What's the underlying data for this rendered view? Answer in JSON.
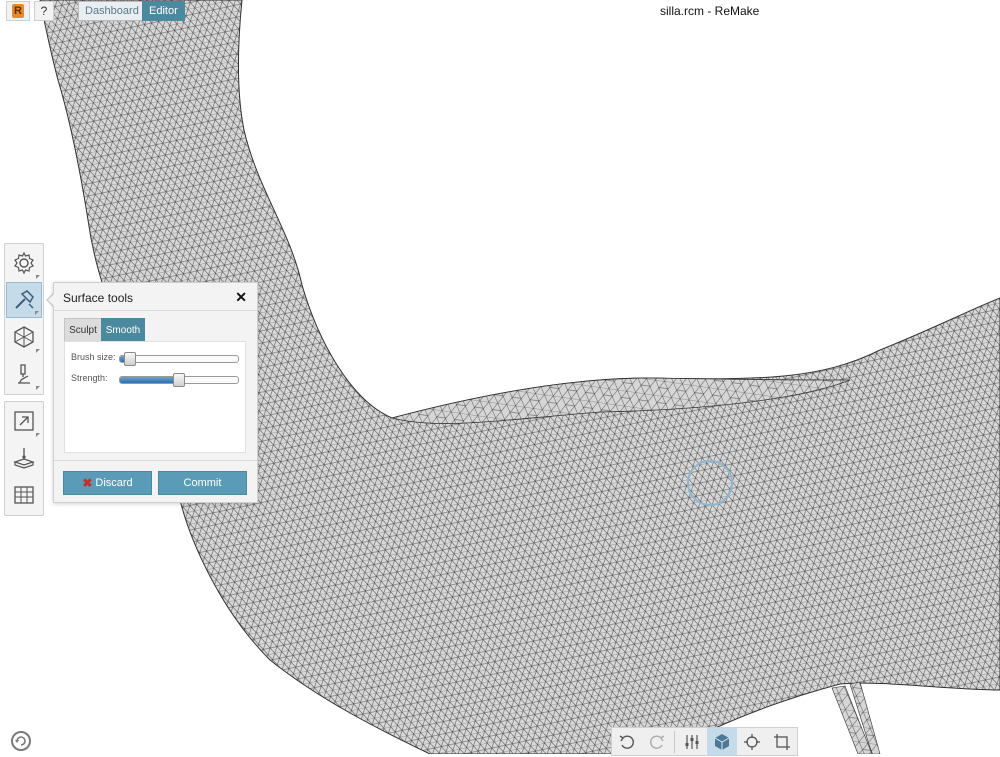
{
  "app": {
    "window_title": "silla.rcm - ReMake",
    "help_label": "?",
    "logo_letter": "R",
    "tabs": [
      {
        "label": "Dashboard",
        "active": false
      },
      {
        "label": "Editor",
        "active": true
      }
    ]
  },
  "left_toolbar": {
    "group1": [
      {
        "icon": "gear-icon"
      },
      {
        "icon": "hammer-icon",
        "active": true
      },
      {
        "icon": "mesh-icon"
      },
      {
        "icon": "microscope-icon"
      }
    ],
    "group2": [
      {
        "icon": "export-icon"
      },
      {
        "icon": "measure-icon"
      },
      {
        "icon": "table-icon"
      }
    ]
  },
  "surface_panel": {
    "title": "Surface tools",
    "close_label": "✕",
    "modes": [
      "Sculpt",
      "Smooth"
    ],
    "active_mode": "Smooth",
    "brush_size_label": "Brush size:",
    "brush_size_value": 0.05,
    "strength_label": "Strength:",
    "strength_value": 0.5,
    "discard_label": "Discard",
    "commit_label": "Commit"
  },
  "bottom_toolbar": [
    "undo-icon",
    "redo-icon",
    "sliders-icon",
    "cube-icon",
    "target-icon",
    "crop-icon"
  ],
  "colors": {
    "accent": "#4b8a9e",
    "button": "#5a9cb8",
    "mesh_fill": "#d9d9d9",
    "mesh_line": "#3d3d3d",
    "active_tool": "#c6dbea"
  }
}
